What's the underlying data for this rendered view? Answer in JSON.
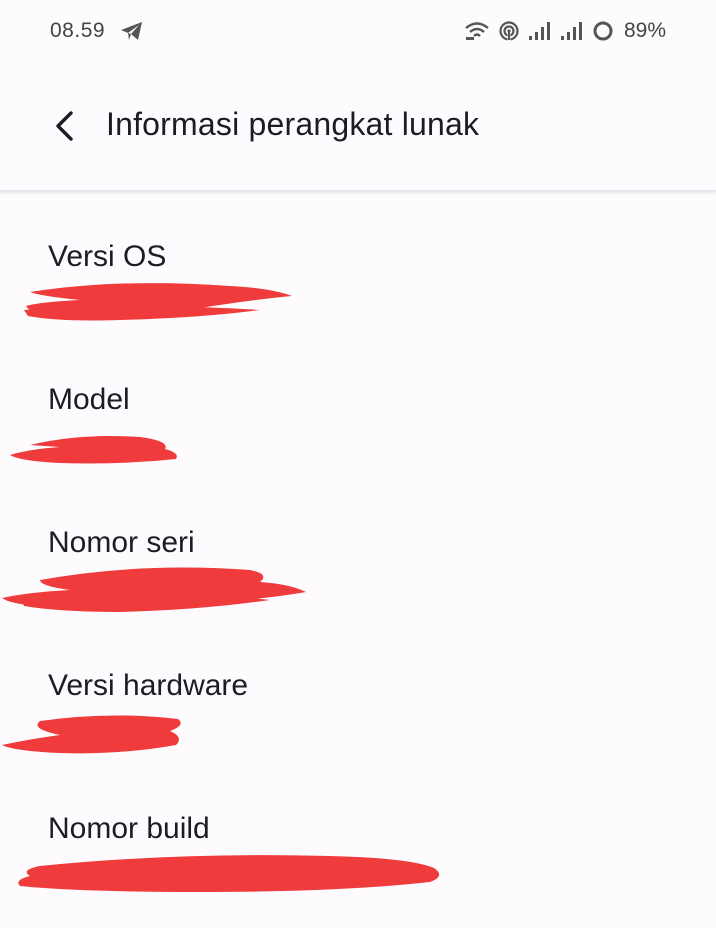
{
  "status_bar": {
    "time": "08.59",
    "battery_percent": "89%",
    "icons": [
      "telegram-icon",
      "wifi-calling-icon",
      "hotspot-icon",
      "signal-icon",
      "signal-icon",
      "battery-saver-icon"
    ]
  },
  "app_bar": {
    "title": "Informasi perangkat lunak",
    "back_icon": "chevron-left-icon"
  },
  "info_items": [
    {
      "label": "Versi OS"
    },
    {
      "label": "Model"
    },
    {
      "label": "Nomor seri"
    },
    {
      "label": "Versi hardware"
    },
    {
      "label": "Nomor build"
    }
  ],
  "colors": {
    "background": "#fdfbfe",
    "text_primary": "#1f1b24",
    "redaction": "#ef3b3b"
  }
}
